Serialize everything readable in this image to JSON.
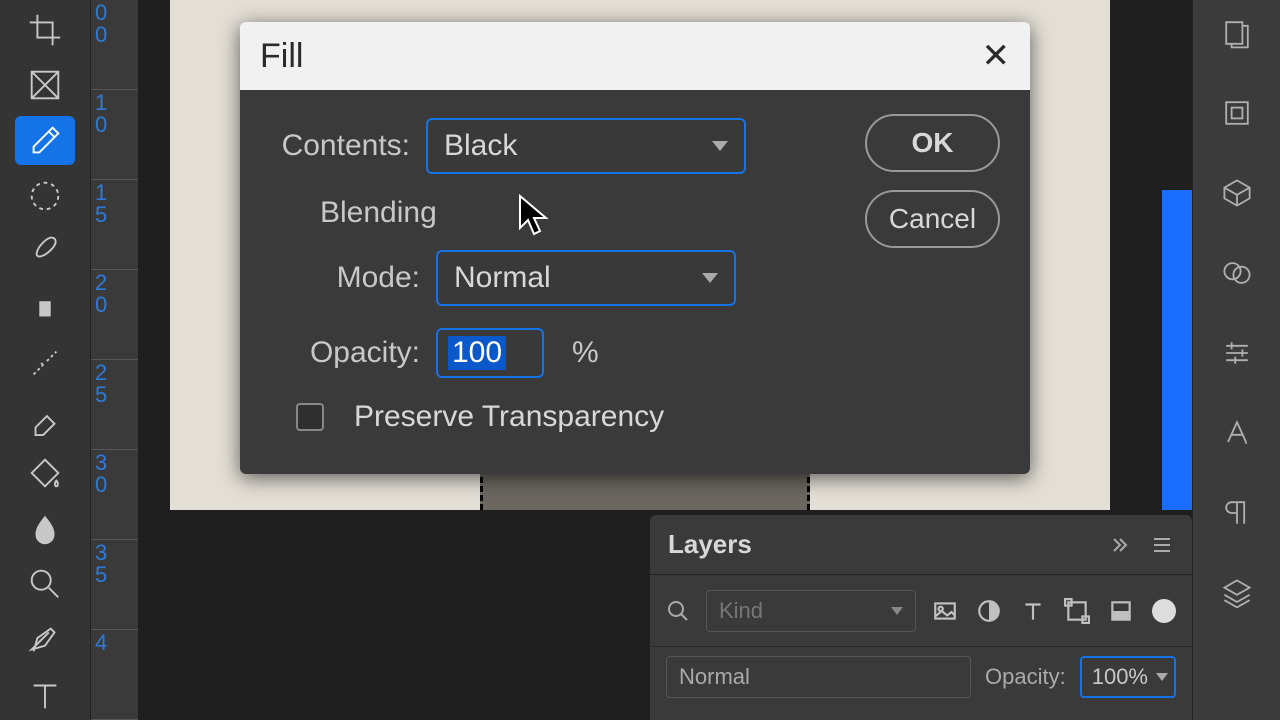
{
  "dialog": {
    "title": "Fill",
    "contents_label": "Contents:",
    "contents_value": "Black",
    "blending_section": "Blending",
    "mode_label": "Mode:",
    "mode_value": "Normal",
    "opacity_label": "Opacity:",
    "opacity_value": "100",
    "opacity_unit": "%",
    "preserve_label": "Preserve Transparency",
    "ok": "OK",
    "cancel": "Cancel"
  },
  "layers_panel": {
    "title": "Layers",
    "kind_placeholder": "Kind",
    "blend_value": "Normal",
    "opacity_label": "Opacity:",
    "opacity_value": "100%"
  },
  "ruler_marks": [
    "0",
    "0",
    "1",
    "0",
    "1",
    "5",
    "2",
    "0",
    "2",
    "5",
    "3",
    "0",
    "3",
    "5",
    "4"
  ]
}
